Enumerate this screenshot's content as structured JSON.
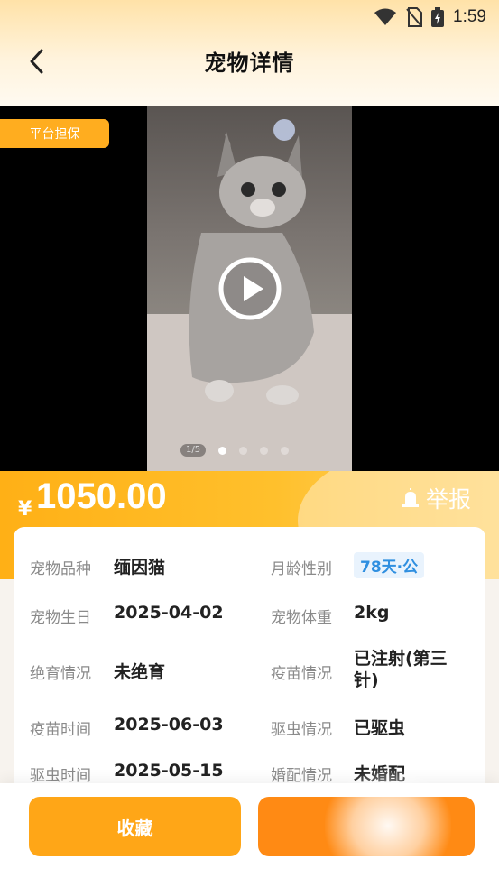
{
  "status_bar": {
    "time": "1:59"
  },
  "header": {
    "title": "宠物详情"
  },
  "media": {
    "badge": "平台担保",
    "counter": "1/5"
  },
  "price": {
    "currency": "¥",
    "amount": "1050.00"
  },
  "report": {
    "label": "举报"
  },
  "details": [
    {
      "label": "宠物品种",
      "value": "缅因猫",
      "label2": "月龄性别",
      "value2": "78天·公"
    },
    {
      "label": "宠物生日",
      "value": "2025-04-02",
      "label2": "宠物体重",
      "value2": "2kg"
    },
    {
      "label": "绝育情况",
      "value": "未绝育",
      "label2": "疫苗情况",
      "value2": "已注射(第三针)"
    },
    {
      "label": "疫苗时间",
      "value": "2025-06-03",
      "label2": "驱虫情况",
      "value2": "已驱虫"
    },
    {
      "label": "驱虫时间",
      "value": "2025-05-15",
      "label2": "婚配情况",
      "value2": "未婚配"
    }
  ],
  "actions": {
    "favorite": "收藏"
  },
  "colors": {
    "accent": "#ffad1f",
    "tag_blue": "#2f8fe0"
  }
}
